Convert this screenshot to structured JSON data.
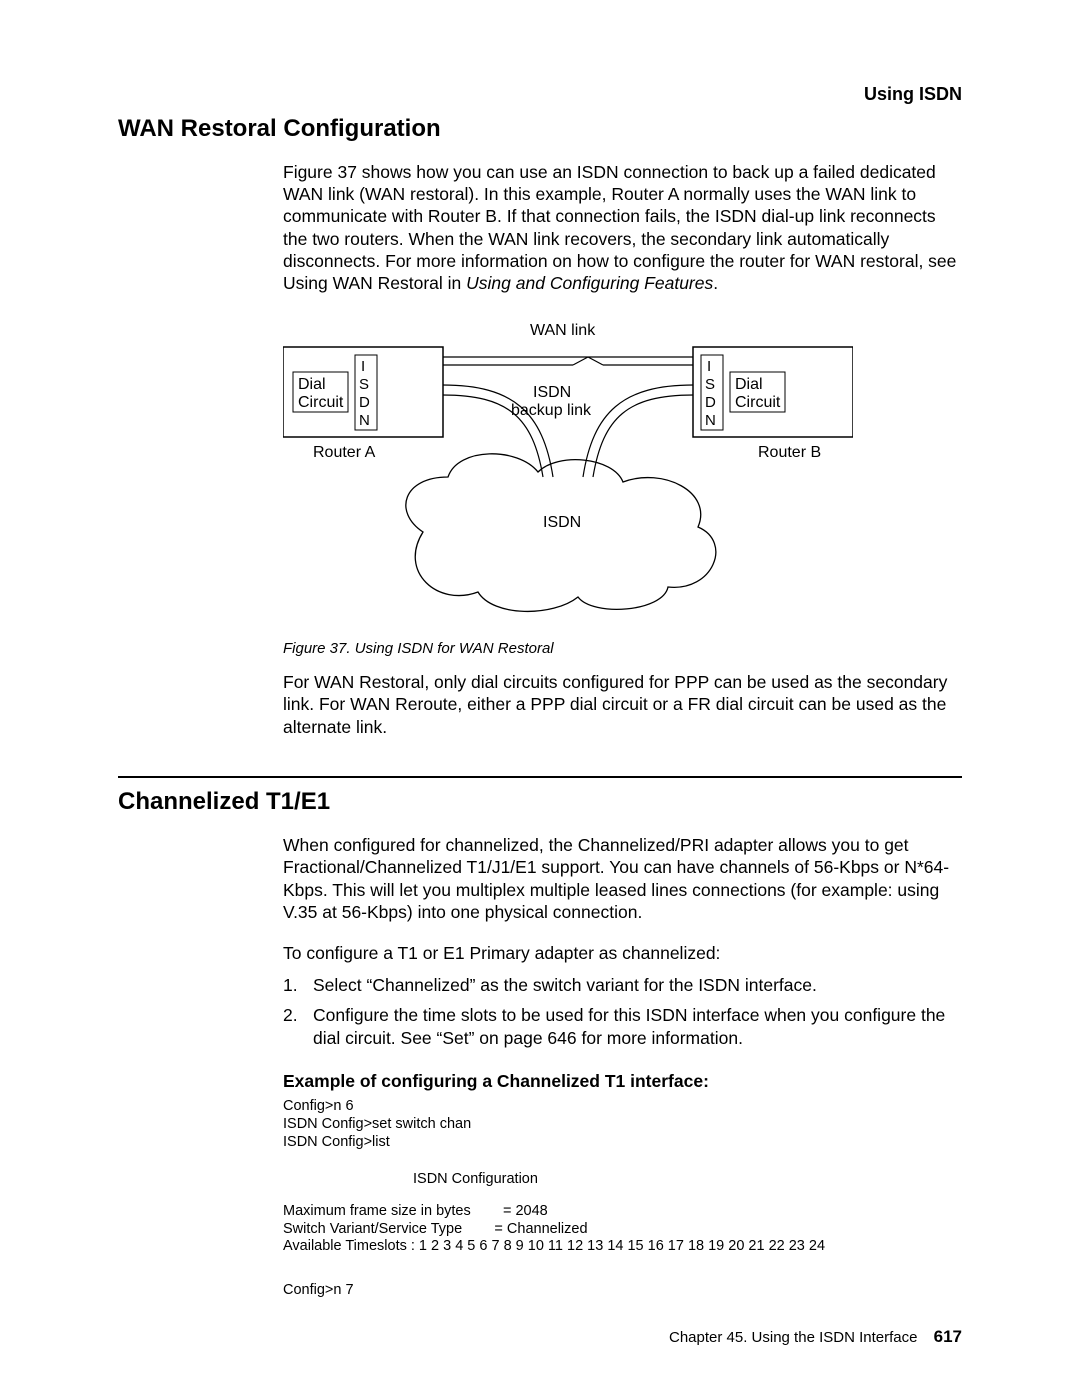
{
  "running_head": "Using ISDN",
  "section1": {
    "title": "WAN Restoral Configuration",
    "para1": "Figure 37 shows how you can use an ISDN connection to back up a failed dedicated WAN link (WAN restoral). In this example, Router A normally uses the WAN link to communicate with Router B. If that connection fails, the ISDN dial-up link reconnects the two routers. When the WAN link recovers, the secondary link automatically disconnects. For more information on how to configure the router for WAN restoral, see Using WAN Restoral in ",
    "para1_italic": "Using and Configuring Features",
    "para1_tail": ".",
    "figure": {
      "wan_link": "WAN link",
      "isdn_backup": "ISDN",
      "isdn_backup2": "backup link",
      "dial_circuit": "Dial",
      "circuit": "Circuit",
      "isdn_vert": "I\nS\nD\nN",
      "router_a": "Router A",
      "router_b": "Router B",
      "isdn_cloud": "ISDN"
    },
    "figure_caption": "Figure 37. Using ISDN for WAN Restoral",
    "para2": "For WAN Restoral, only dial circuits configured for PPP can be used as the secondary link. For WAN Reroute, either a PPP dial circuit or a FR dial circuit can be used as the alternate link."
  },
  "section2": {
    "title": "Channelized T1/E1",
    "para1": "When configured for channelized, the Channelized/PRI adapter allows you to get Fractional/Channelized T1/J1/E1 support. You can have channels of 56-Kbps or N*64-Kbps. This will let you multiplex multiple leased lines connections (for example: using V.35 at 56-Kbps) into one physical connection.",
    "para2": "To configure a T1 or E1 Primary adapter as channelized:",
    "list": [
      "Select “Channelized” as the switch variant for the ISDN interface.",
      "Configure the time slots to be used for this ISDN interface when you configure the dial circuit. See “Set” on page 646 for more information."
    ],
    "example_head": "Example of configuring a Channelized T1 interface:",
    "term_block1": "Config>n 6\nISDN Config>set switch chan\nISDN Config>list",
    "term_title": "ISDN Configuration",
    "term_block2": "Maximum frame size in bytes        = 2048\nSwitch Variant/Service Type        = Channelized\nAvailable Timeslots : 1 2 3 4 5 6 7 8 9 10 11 12 13 14 15 16 17 18 19 20 21 22 23 24",
    "term_block3": "Config>n 7"
  },
  "footer": {
    "chapter": "Chapter 45. Using the ISDN Interface",
    "page": "617"
  }
}
